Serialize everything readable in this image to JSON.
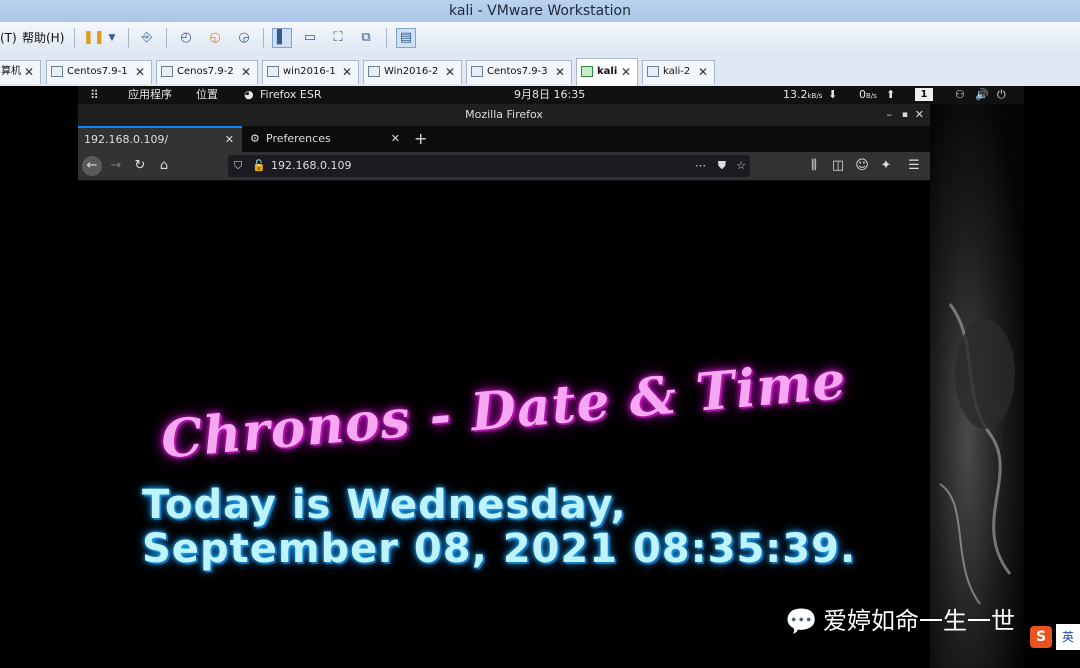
{
  "vmware": {
    "title": "kali - VMware Workstation",
    "menu": {
      "partial_left": "(T)",
      "help": "帮助(H)"
    },
    "tabs": [
      {
        "label": "算机",
        "active": false
      },
      {
        "label": "Centos7.9-1",
        "active": false
      },
      {
        "label": "Cenos7.9-2",
        "active": false
      },
      {
        "label": "win2016-1",
        "active": false
      },
      {
        "label": "Win2016-2",
        "active": false
      },
      {
        "label": "Centos7.9-3",
        "active": false
      },
      {
        "label": "kali",
        "active": true
      },
      {
        "label": "kali-2",
        "active": false
      }
    ],
    "close_glyph": "✕"
  },
  "kali_panel": {
    "apps": "应用程序",
    "places": "位置",
    "browser": "Firefox ESR",
    "datetime": "9月8日  16:35",
    "net_down": "13.2",
    "net_down_unit": "kB/s",
    "net_up": "0",
    "net_up_unit": "B/s",
    "workspace": "1"
  },
  "firefox": {
    "window_title": "Mozilla Firefox",
    "tabs": [
      {
        "label": "192.168.0.109/",
        "active": true
      },
      {
        "label": "Preferences",
        "active": false
      }
    ],
    "new_tab": "+",
    "url": "192.168.0.109"
  },
  "page": {
    "title": "Chronos - Date & Time",
    "line1": "Today is Wednesday,",
    "line2": "September 08, 2021 08:35:39."
  },
  "watermark": "爱婷如命一生一世",
  "ime_label": "英",
  "colors": {
    "neon_pink": "#f7a8f3",
    "neon_blue": "#bff4ff",
    "firefox_accent": "#0a84ff"
  }
}
